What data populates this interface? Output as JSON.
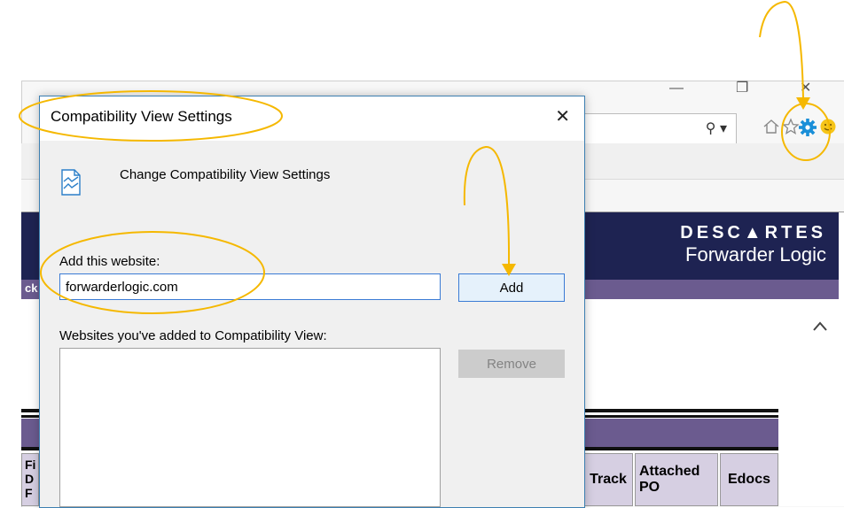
{
  "browser": {
    "window_controls": {
      "minimize": "—",
      "restore": "❐",
      "close": "✕"
    },
    "address_bar": {
      "search_glyph": "⚲ ▾"
    },
    "toolbar_icons": [
      "home-icon",
      "favorites-star-icon",
      "tools-gear-icon",
      "feedback-smiley-icon"
    ]
  },
  "page": {
    "brand_line1": "DESC▲RTES",
    "brand_line2": "Forwarder Logic",
    "subbar_fragment": "ck",
    "table": {
      "left_col_fragment": "Fi D F",
      "headers": {
        "track": "Track",
        "attached_po": "Attached PO",
        "edocs": "Edocs"
      }
    }
  },
  "dialog": {
    "title": "Compatibility View Settings",
    "close_glyph": "✕",
    "heading": "Change Compatibility View Settings",
    "add_label": "Add this website:",
    "input_value": "forwarderlogic.com",
    "add_button": "Add",
    "list_label": "Websites you've added to Compatibility View:",
    "remove_button": "Remove",
    "added_sites": []
  },
  "colors": {
    "annotation": "#f5b800",
    "dialog_border": "#3c7fb1",
    "banner": "#1e2352",
    "subbar": "#6b5b8f",
    "table_header_cell": "#d6cfe2",
    "gear": "#1a8fd8"
  }
}
